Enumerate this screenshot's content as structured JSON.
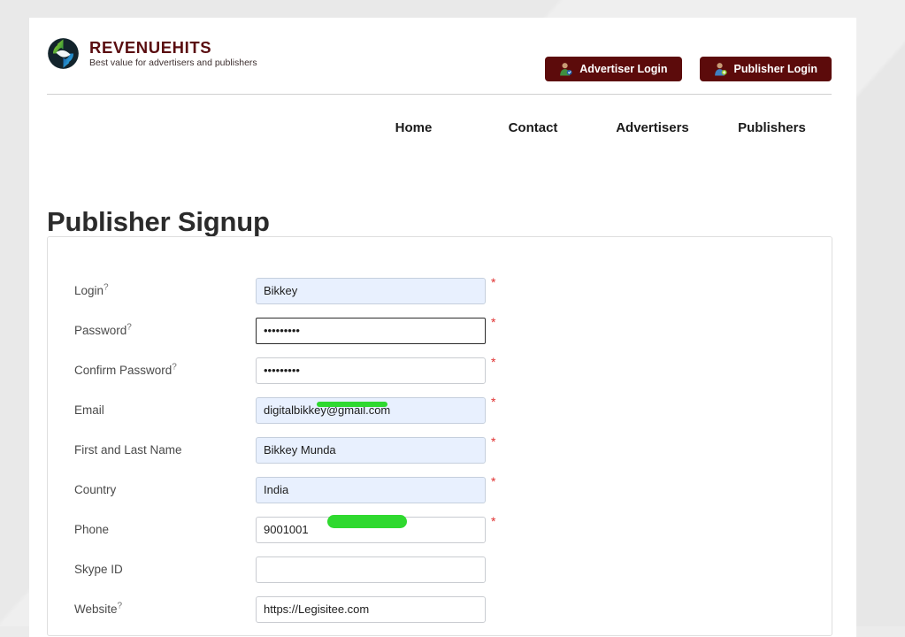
{
  "brand": {
    "name": "REVENUEHITS",
    "tagline": "Best value for advertisers and publishers",
    "logo_icon": "recycle-circle-logo"
  },
  "header": {
    "advertiser_login_label": "Advertiser Login",
    "publisher_login_label": "Publisher Login",
    "advertiser_icon": "person-green-icon",
    "publisher_icon": "person-blue-icon",
    "button_color": "#5c0b0b"
  },
  "nav": {
    "items": [
      {
        "label": "Home"
      },
      {
        "label": "Contact"
      },
      {
        "label": "Advertisers"
      },
      {
        "label": "Publishers"
      }
    ]
  },
  "main": {
    "title": "Publisher Signup"
  },
  "form": {
    "required_marker": "*",
    "help_marker": "?",
    "fields": [
      {
        "label": "Login",
        "help": true,
        "type": "text",
        "value": "Bikkey",
        "placeholder": "",
        "required": true,
        "state": "autofill"
      },
      {
        "label": "Password",
        "help": true,
        "type": "password",
        "value": "•••••••••",
        "placeholder": "",
        "required": true,
        "state": "focused"
      },
      {
        "label": "Confirm Password",
        "help": true,
        "type": "password",
        "value": "•••••••••",
        "placeholder": "",
        "required": true,
        "state": "normal"
      },
      {
        "label": "Email",
        "help": false,
        "type": "email",
        "value": "digitalbikkey@gmail.com",
        "placeholder": "",
        "required": true,
        "state": "autofill",
        "redacted": "email"
      },
      {
        "label": "First and Last Name",
        "help": false,
        "type": "text",
        "value": "Bikkey Munda",
        "placeholder": "",
        "required": true,
        "state": "autofill"
      },
      {
        "label": "Country",
        "help": false,
        "type": "select",
        "value": "India",
        "placeholder": "",
        "required": true,
        "state": "autofill"
      },
      {
        "label": "Phone",
        "help": false,
        "type": "tel",
        "value": "9001001",
        "placeholder": "",
        "required": true,
        "state": "normal",
        "redacted": "phone"
      },
      {
        "label": "Skype ID",
        "help": false,
        "type": "text",
        "value": "",
        "placeholder": "",
        "required": false,
        "state": "normal"
      },
      {
        "label": "Website",
        "help": true,
        "type": "url",
        "value": "https://Legisitee.com",
        "placeholder": "",
        "required": false,
        "state": "normal"
      }
    ]
  },
  "colors": {
    "page_background": "#ebebeb",
    "card_background": "#ffffff",
    "brand_maroon": "#5a0d10",
    "autofill_blue": "#e8f0fe",
    "required_red": "#e03030",
    "redaction_green": "#2fd92f"
  }
}
